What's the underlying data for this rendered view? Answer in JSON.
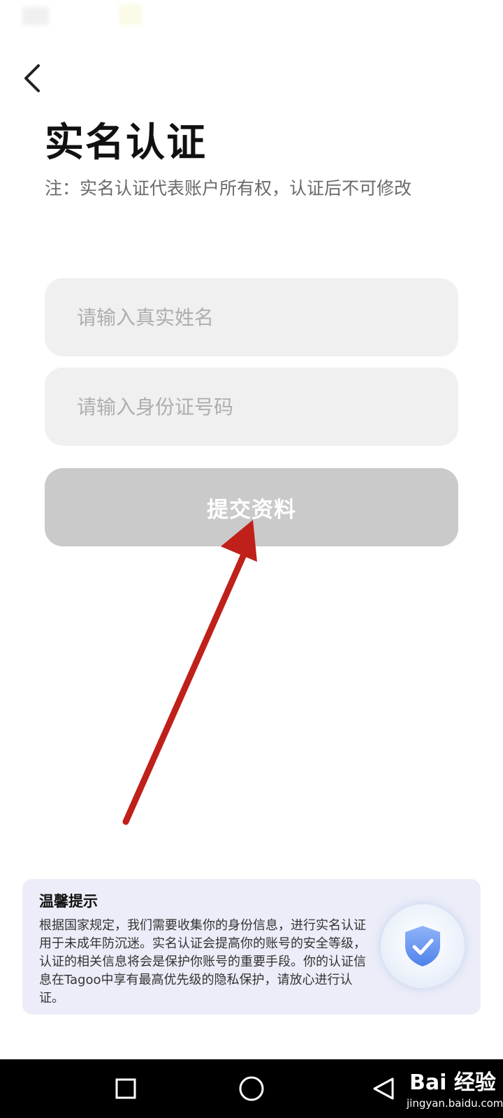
{
  "header": {
    "title": "实名认证",
    "note": "注：实名认证代表账户所有权，认证后不可修改"
  },
  "form": {
    "name_placeholder": "请输入真实姓名",
    "id_placeholder": "请输入身份证号码",
    "submit_label": "提交资料"
  },
  "tips": {
    "title": "温馨提示",
    "body": "根据国家规定，我们需要收集你的身份信息，进行实名认证用于未成年防沉迷。实名认证会提高你的账号的安全等级，认证的相关信息将会是保护你账号的重要手段。你的认证信息在Tagoo中享有最高优先级的隐私保护，请放心进行认证。"
  },
  "watermark": {
    "main": "Bai 经验",
    "sub": "jingyan.baidu.com"
  },
  "colors": {
    "field_bg": "#f0f0f0",
    "button_disabled": "#cacaca",
    "tips_bg": "#ecedf8",
    "shield_blue": "#5b8ef0",
    "annotation_red": "#c0201a"
  },
  "icons": {
    "back": "chevron-left-icon",
    "shield": "shield-check-icon",
    "nav_recents": "square-icon",
    "nav_home": "circle-icon",
    "nav_back": "triangle-back-icon"
  }
}
